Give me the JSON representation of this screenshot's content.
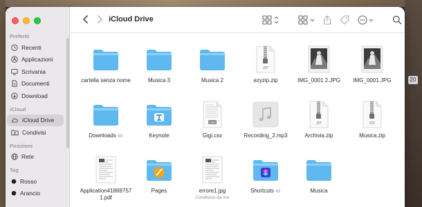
{
  "window": {
    "title": "iCloud Drive"
  },
  "sidebar": {
    "sections": [
      {
        "title": "Preferiti",
        "items": [
          {
            "label": "Recenti",
            "icon": "clock-icon"
          },
          {
            "label": "Applicazioni",
            "icon": "applications-icon"
          },
          {
            "label": "Scrivania",
            "icon": "desktop-icon"
          },
          {
            "label": "Documenti",
            "icon": "document-icon"
          },
          {
            "label": "Download",
            "icon": "download-icon"
          }
        ]
      },
      {
        "title": "iCloud",
        "items": [
          {
            "label": "iCloud Drive",
            "icon": "cloud-icon",
            "active": true
          },
          {
            "label": "Condivisi",
            "icon": "shared-folder-icon"
          }
        ]
      },
      {
        "title": "Posizioni",
        "items": [
          {
            "label": "Rete",
            "icon": "network-icon"
          }
        ]
      },
      {
        "title": "Tag",
        "items": [
          {
            "label": "Rosso",
            "icon": "tag-dot-icon"
          },
          {
            "label": "Arancio",
            "icon": "tag-dot-icon"
          }
        ]
      }
    ]
  },
  "files": [
    {
      "name": "cartella senza nome",
      "type": "folder"
    },
    {
      "name": "Musica 3",
      "type": "folder"
    },
    {
      "name": "Musica 2",
      "type": "folder"
    },
    {
      "name": "ezyzip.zip",
      "type": "zip",
      "badge": "ZIP"
    },
    {
      "name": "IMG_0001 2.JPG",
      "type": "photo"
    },
    {
      "name": "IMG_0001.JPG",
      "type": "photo"
    },
    {
      "name": "Downloads",
      "type": "folder",
      "cloud": true
    },
    {
      "name": "Keynote",
      "type": "keynote-folder"
    },
    {
      "name": "Gigi.csv",
      "type": "csv",
      "badge": "CSV"
    },
    {
      "name": "Recording_2.mp3",
      "type": "audio"
    },
    {
      "name": "Archivia.zip",
      "type": "zip",
      "badge": "ZIP"
    },
    {
      "name": "Musica.zip",
      "type": "zip",
      "badge": "ZIP"
    },
    {
      "name": "Application418697571.pdf",
      "type": "doc"
    },
    {
      "name": "Pages",
      "type": "pages-folder"
    },
    {
      "name": "errore1.jpg",
      "type": "doc",
      "subtitle": "Condiviso da me"
    },
    {
      "name": "Shortcuts",
      "type": "shortcuts-folder",
      "cloud": true
    },
    {
      "name": "Musica",
      "type": "folder"
    }
  ],
  "desktop": {
    "badge": "20"
  },
  "colors": {
    "folder": "#5fb8f0",
    "folder_tab": "#8fd1f8",
    "tag_red": "#ff3b30",
    "tag_orange": "#ff9500"
  }
}
